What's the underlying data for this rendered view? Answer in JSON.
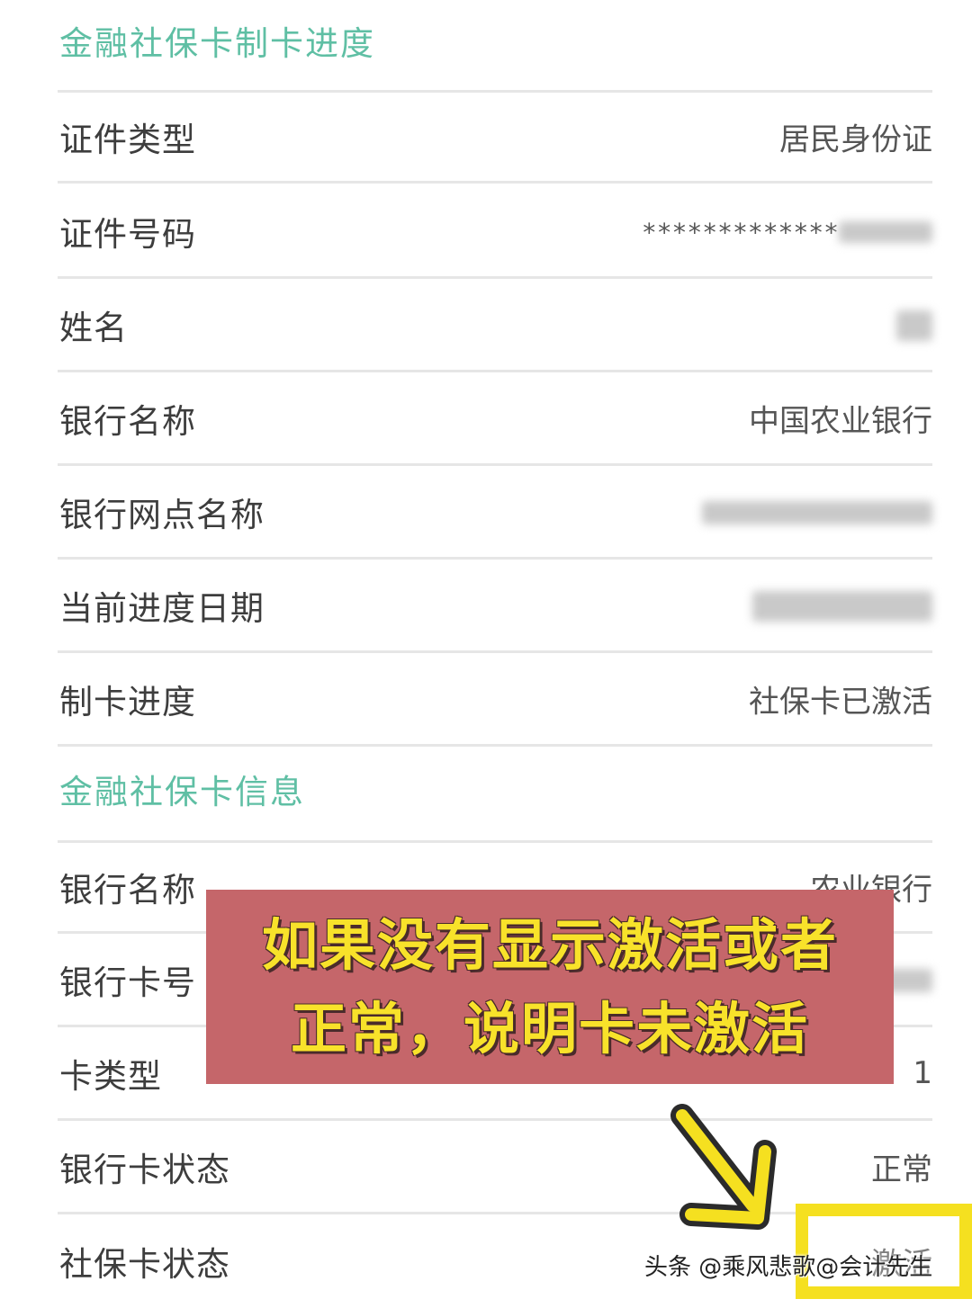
{
  "section1": {
    "title": "金融社保卡制卡进度",
    "rows": [
      {
        "label": "证件类型",
        "value": "居民身份证"
      },
      {
        "label": "证件号码",
        "value": "*************"
      },
      {
        "label": "姓名",
        "value": ""
      },
      {
        "label": "银行名称",
        "value": "中国农业银行"
      },
      {
        "label": "银行网点名称",
        "value": ""
      },
      {
        "label": "当前进度日期",
        "value": ""
      },
      {
        "label": "制卡进度",
        "value": "社保卡已激活"
      }
    ]
  },
  "section2": {
    "title": "金融社保卡信息",
    "rows": [
      {
        "label": "银行名称",
        "value": "农业银行"
      },
      {
        "label": "银行卡号",
        "value": ""
      },
      {
        "label": "卡类型",
        "value": "1"
      },
      {
        "label": "银行卡状态",
        "value": "正常"
      },
      {
        "label": "社保卡状态",
        "value": "激活"
      }
    ]
  },
  "overlay": {
    "line1": "如果没有显示激活或者",
    "line2": "正常，说明卡未激活"
  },
  "watermark": "头条 @乘风悲歌@会计先生",
  "colors": {
    "section_title": "#5fbfa4",
    "overlay_bg": "#c5666a",
    "overlay_text": "#f8e22a",
    "highlight": "#f5e020"
  },
  "icons": {
    "arrow": "arrow-down-right-icon"
  }
}
